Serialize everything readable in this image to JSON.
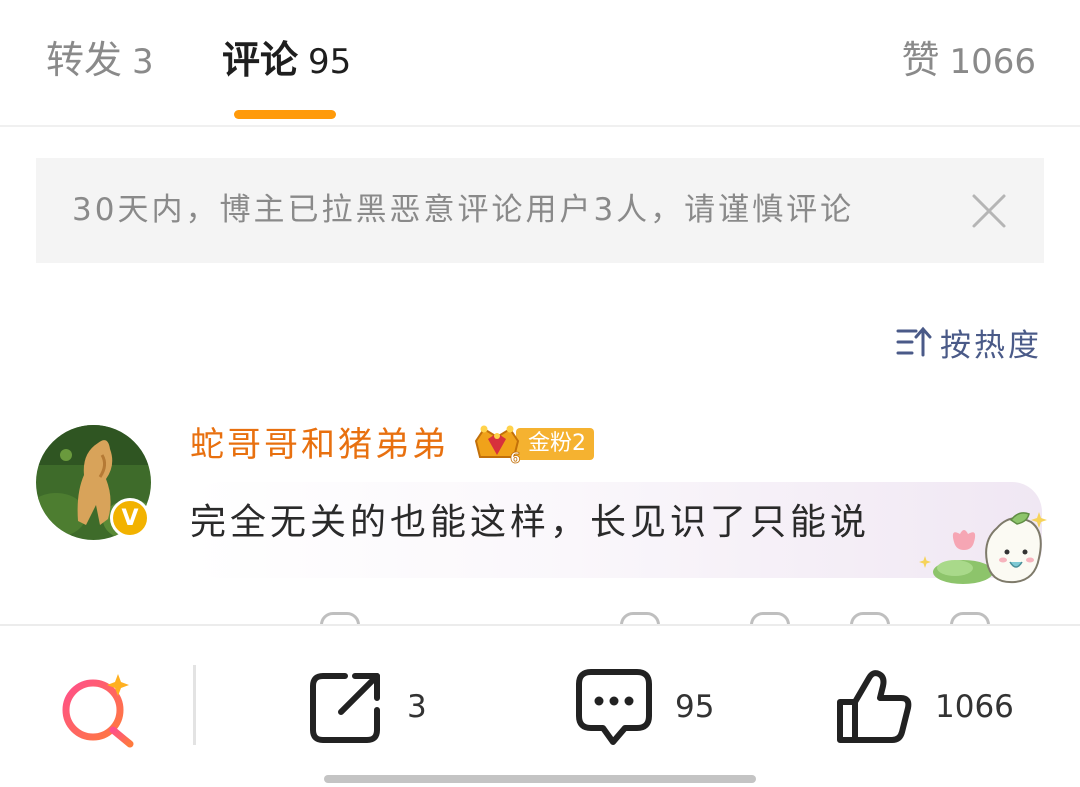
{
  "colors": {
    "accent": "#ff9a0a",
    "username": "#e8700f",
    "sort_link": "#4a5a88",
    "fan_badge": "#f5b230",
    "verify": "#f2b200",
    "ai_gradient_start": "#ff4f8a",
    "ai_gradient_end": "#ff7a3d"
  },
  "tabs": {
    "repost": {
      "label": "转发",
      "count": "3"
    },
    "comments": {
      "label": "评论",
      "count": "95"
    },
    "likes": {
      "label": "赞",
      "count": "1066"
    }
  },
  "notice": {
    "text": "30天内，博主已拉黑恶意评论用户3人，请谨慎评论",
    "close_icon": "close-icon"
  },
  "sort": {
    "label": "按热度",
    "icon": "sort-descending-icon"
  },
  "comment": {
    "username": "蛇哥哥和猪弟弟",
    "fan_level": "6",
    "fan_badge_label": "金粉2",
    "verified_mark": "V",
    "text": "完全无关的也能这样，长见识了只能说"
  },
  "action_bar": {
    "ai_search_icon": "ai-search-icon",
    "share_count": "3",
    "comment_count": "95",
    "like_count": "1066"
  }
}
